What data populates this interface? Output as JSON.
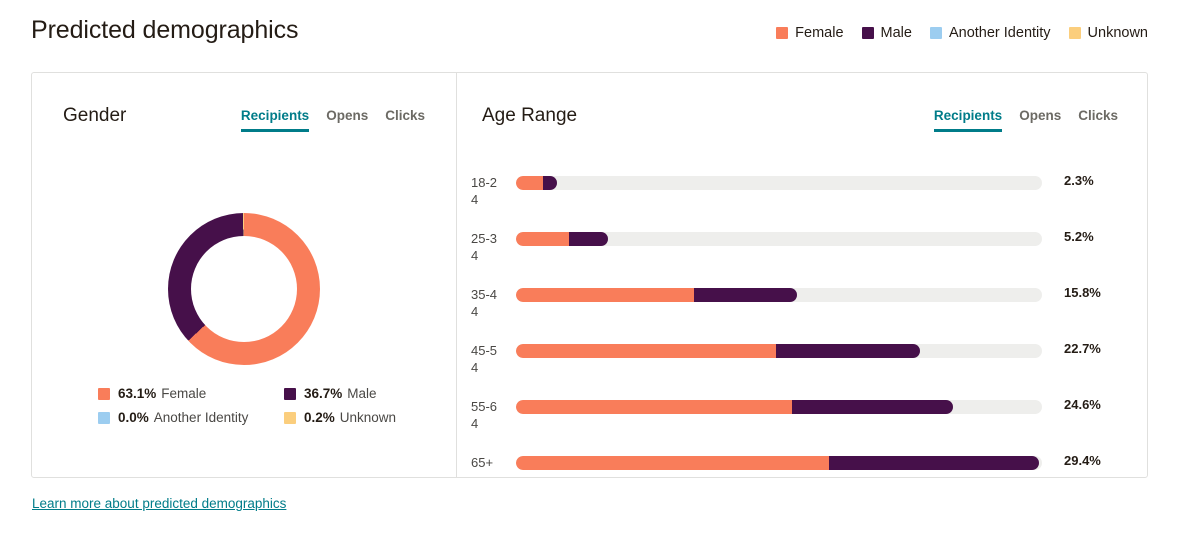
{
  "page": {
    "title": "Predicted demographics",
    "footer_link": "Learn more about predicted demographics"
  },
  "colors": {
    "female": "#f97d5a",
    "male": "#46104a",
    "another_identity": "#9ccdf0",
    "unknown": "#fbce7d",
    "track": "#eeeeec",
    "accent": "#007c89",
    "border": "#e0e0de",
    "text": "#241c15",
    "muted": "#6c6a64"
  },
  "top_legend": [
    {
      "label": "Female",
      "color": "#f97d5a",
      "icon": "legend-swatch-female"
    },
    {
      "label": "Male",
      "color": "#46104a",
      "icon": "legend-swatch-male"
    },
    {
      "label": "Another Identity",
      "color": "#9ccdf0",
      "icon": "legend-swatch-another-identity"
    },
    {
      "label": "Unknown",
      "color": "#fbce7d",
      "icon": "legend-swatch-unknown"
    }
  ],
  "gender_card": {
    "title": "Gender",
    "tabs": [
      {
        "label": "Recipients",
        "active": true
      },
      {
        "label": "Opens",
        "active": false
      },
      {
        "label": "Clicks",
        "active": false
      }
    ],
    "legend": [
      {
        "pct": "63.1%",
        "label": "Female",
        "color": "#f97d5a"
      },
      {
        "pct": "36.7%",
        "label": "Male",
        "color": "#46104a"
      },
      {
        "pct": "0.0%",
        "label": "Another Identity",
        "color": "#9ccdf0"
      },
      {
        "pct": "0.2%",
        "label": "Unknown",
        "color": "#fbce7d"
      }
    ]
  },
  "age_card": {
    "title": "Age Range",
    "tabs": [
      {
        "label": "Recipients",
        "active": true
      },
      {
        "label": "Opens",
        "active": false
      },
      {
        "label": "Clicks",
        "active": false
      }
    ]
  },
  "chart_data": [
    {
      "type": "pie",
      "title": "Gender",
      "subtitle": "Recipients",
      "labels": [
        "Female",
        "Male",
        "Another Identity",
        "Unknown"
      ],
      "values": [
        63.1,
        36.7,
        0.0,
        0.2
      ],
      "value_labels": [
        "63.1%",
        "36.7%",
        "0.0%",
        "0.2%"
      ],
      "colors": [
        "#f97d5a",
        "#46104a",
        "#9ccdf0",
        "#fbce7d"
      ],
      "donut": true,
      "hole_ratio": 0.7,
      "start_angle_deg": 0,
      "direction": "clockwise",
      "legend_position": "bottom",
      "units": "percent"
    },
    {
      "type": "bar",
      "orientation": "horizontal",
      "stacked": true,
      "title": "Age Range",
      "subtitle": "Recipients",
      "xlabel": "",
      "ylabel": "",
      "grid": false,
      "legend_position": "top",
      "categories": [
        "18-24",
        "25-34",
        "35-44",
        "45-54",
        "55-64",
        "65+"
      ],
      "totals": [
        2.3,
        5.2,
        15.8,
        22.7,
        24.6,
        29.4
      ],
      "total_labels": [
        "2.3%",
        "5.2%",
        "15.8%",
        "22.7%",
        "24.6%",
        "29.4%"
      ],
      "axis_max": 100,
      "track_max_pct": 29.4,
      "series": [
        {
          "name": "Female",
          "color": "#f97d5a",
          "values": [
            1.5,
            3.0,
            10.0,
            14.6,
            15.5,
            17.6
          ]
        },
        {
          "name": "Male",
          "color": "#46104a",
          "values": [
            0.8,
            2.2,
            5.8,
            8.1,
            9.1,
            11.8
          ]
        }
      ],
      "units": "percent"
    }
  ],
  "age_rows": [
    {
      "label": "18-24",
      "pct": "2.3%",
      "total": 2.3,
      "female": 1.5,
      "male": 0.8
    },
    {
      "label": "25-34",
      "pct": "5.2%",
      "total": 5.2,
      "female": 3.0,
      "male": 2.2
    },
    {
      "label": "35-44",
      "pct": "15.8%",
      "total": 15.8,
      "female": 10.0,
      "male": 5.8
    },
    {
      "label": "45-54",
      "pct": "22.7%",
      "total": 22.7,
      "female": 14.6,
      "male": 8.1
    },
    {
      "label": "55-64",
      "pct": "24.6%",
      "total": 24.6,
      "female": 15.5,
      "male": 9.1
    },
    {
      "label": "65+",
      "pct": "29.4%",
      "total": 29.4,
      "female": 17.6,
      "male": 11.8
    }
  ]
}
